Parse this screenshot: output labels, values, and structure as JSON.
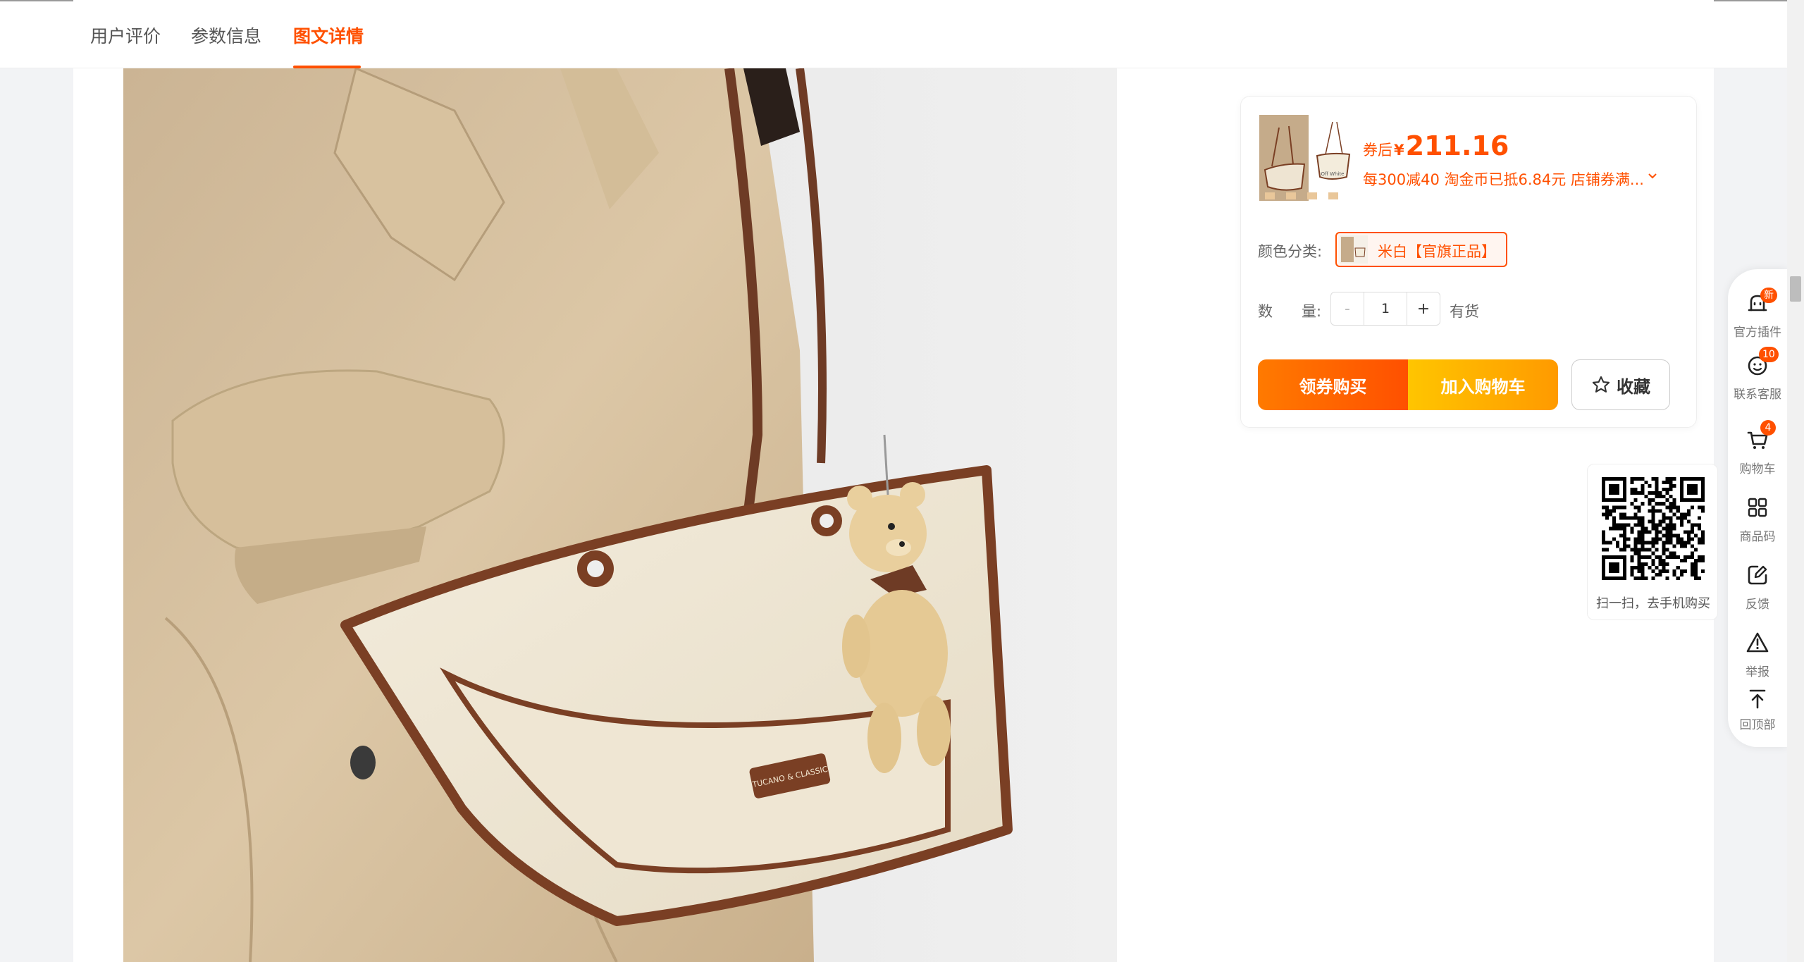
{
  "tabs": [
    {
      "label": "用户评价"
    },
    {
      "label": "参数信息"
    },
    {
      "label": "图文详情"
    }
  ],
  "active_tab_index": 2,
  "product": {
    "price_prefix": "券后",
    "currency_symbol": "¥",
    "price": "211.16",
    "promo_text": "每300减40 淘金币已抵6.84元 店铺券满...",
    "color_label": "颜色分类:",
    "selected_color": "米白【官旗正品】",
    "qty_label_1": "数",
    "qty_label_2": "量:",
    "qty_minus": "-",
    "quantity": "1",
    "qty_plus": "+",
    "stock_status": "有货",
    "buy_button": "领券购买",
    "cart_button": "加入购物车",
    "favorite_button": "收藏",
    "thumb_text": "Off White",
    "bag_logo_text": "TUCANO & CLASSIC"
  },
  "qr": {
    "caption": "扫一扫，去手机购买"
  },
  "sidebar": {
    "items": [
      {
        "label": "官方插件",
        "icon": "plugin-icon",
        "badge": "新"
      },
      {
        "label": "联系客服",
        "icon": "customer-service-icon",
        "badge": "10"
      },
      {
        "label": "购物车",
        "icon": "cart-icon",
        "badge": "4"
      },
      {
        "label": "商品码",
        "icon": "grid-code-icon"
      },
      {
        "label": "反馈",
        "icon": "feedback-edit-icon"
      },
      {
        "label": "举报",
        "icon": "warning-icon"
      },
      {
        "label": "回顶部",
        "icon": "back-to-top-icon"
      }
    ]
  },
  "colors": {
    "accent": "#ff5000",
    "cart_gradient_start": "#ffc500",
    "buy_gradient_start": "#ff7a00"
  }
}
